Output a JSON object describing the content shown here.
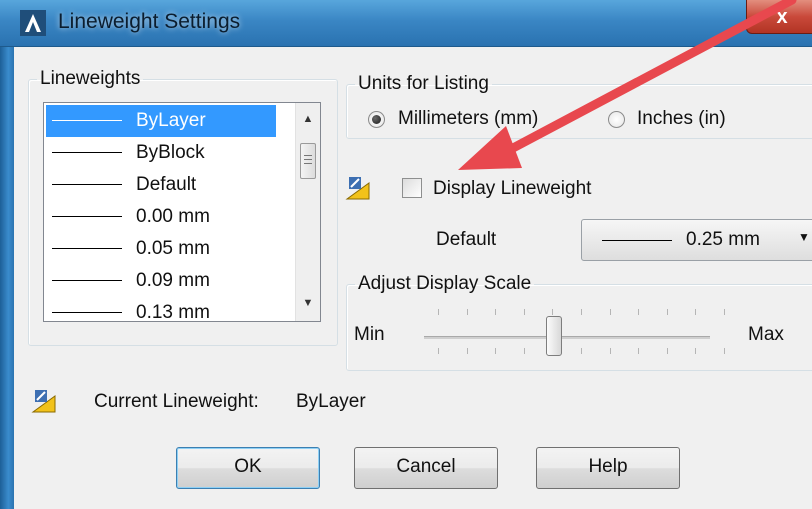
{
  "window": {
    "title": "Lineweight Settings",
    "close_label": "x"
  },
  "lineweights": {
    "legend": "Lineweights",
    "items": [
      {
        "label": "ByLayer",
        "selected": true
      },
      {
        "label": "ByBlock",
        "selected": false
      },
      {
        "label": "Default",
        "selected": false
      },
      {
        "label": "0.00 mm",
        "selected": false
      },
      {
        "label": "0.05 mm",
        "selected": false
      },
      {
        "label": "0.09 mm",
        "selected": false
      },
      {
        "label": "0.13 mm",
        "selected": false
      }
    ]
  },
  "units": {
    "legend": "Units for Listing",
    "millimeters_label": "Millimeters (mm)",
    "inches_label": "Inches (in)",
    "selected": "millimeters"
  },
  "display_lineweight": {
    "label": "Display Lineweight",
    "checked": false
  },
  "default_setting": {
    "label": "Default",
    "value": "0.25 mm"
  },
  "display_scale": {
    "legend": "Adjust Display Scale",
    "min_label": "Min",
    "max_label": "Max",
    "level_fraction": 0.45
  },
  "current": {
    "label": "Current Lineweight:",
    "value": "ByLayer"
  },
  "buttons": {
    "ok": "OK",
    "cancel": "Cancel",
    "help": "Help"
  },
  "colors": {
    "selection": "#3399ff",
    "annotation_arrow": "#e8484e",
    "titlebar": "#3a86c4"
  }
}
